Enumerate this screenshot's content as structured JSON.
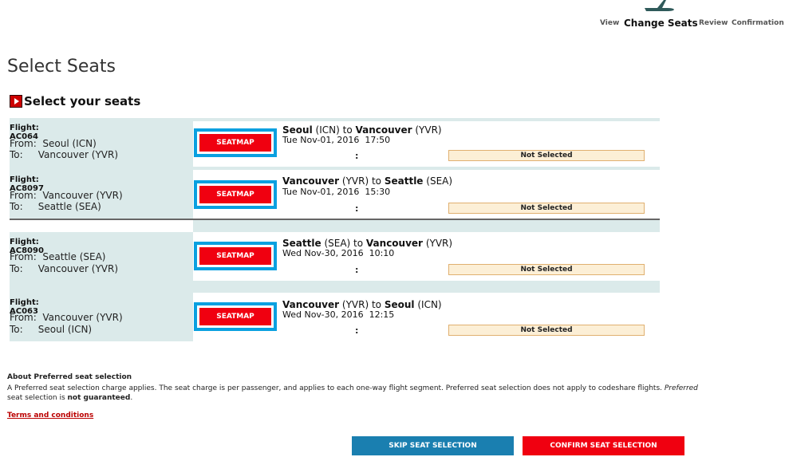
{
  "header": {
    "steps": [
      "View",
      "Change Seats",
      "Review",
      "Confirmation"
    ],
    "active_step": "Change Seats"
  },
  "page_title": "Select Seats",
  "section_title": "Select your seats",
  "flights": [
    {
      "flight_label": "Flight: AC064",
      "from": "From:  Seoul (ICN)",
      "to": "To:     Vancouver (YVR)",
      "route_from_city": "Seoul",
      "route_from_code": "(ICN)",
      "route_to_word": "to",
      "route_to_city": "Vancouver",
      "route_to_code": "(YVR)",
      "datetime": "Tue Nov-01, 2016  17:50",
      "seatmap": "SEATMAP",
      "seat_colon": ":",
      "status": "Not Selected"
    },
    {
      "flight_label": "Flight: AC8097",
      "from": "From:  Vancouver (YVR)",
      "to": "To:     Seattle (SEA)",
      "route_from_city": "Vancouver",
      "route_from_code": "(YVR)",
      "route_to_word": "to",
      "route_to_city": "Seattle",
      "route_to_code": "(SEA)",
      "datetime": "Tue Nov-01, 2016  15:30",
      "seatmap": "SEATMAP",
      "seat_colon": ":",
      "status": "Not Selected"
    },
    {
      "flight_label": "Flight: AC8090",
      "from": "From:  Seattle (SEA)",
      "to": "To:     Vancouver (YVR)",
      "route_from_city": "Seattle",
      "route_from_code": "(SEA)",
      "route_to_word": "to",
      "route_to_city": "Vancouver",
      "route_to_code": "(YVR)",
      "datetime": "Wed Nov-30, 2016  10:10",
      "seatmap": "SEATMAP",
      "seat_colon": ":",
      "status": "Not Selected"
    },
    {
      "flight_label": "Flight: AC063",
      "from": "From:  Vancouver (YVR)",
      "to": "To:     Seoul (ICN)",
      "route_from_city": "Vancouver",
      "route_from_code": "(YVR)",
      "route_to_word": "to",
      "route_to_city": "Seoul",
      "route_to_code": "(ICN)",
      "datetime": "Wed Nov-30, 2016  12:15",
      "seatmap": "SEATMAP",
      "seat_colon": ":",
      "status": "Not Selected"
    }
  ],
  "about": {
    "title": "About Preferred seat selection",
    "text1": "A Preferred seat selection charge applies. The seat charge is per passenger, and applies to each one-way flight segment. Preferred seat selection does not apply to codeshare flights. ",
    "text_italic": "Preferred",
    "text2": " seat selection is ",
    "text_bold": "not guaranteed",
    "text3": "."
  },
  "terms_link": "Terms and conditions",
  "buttons": {
    "skip": "SKIP SEAT SELECTION",
    "confirm": "CONFIRM SEAT SELECTION"
  },
  "colors": {
    "skip": "#1a7fb0",
    "confirm": "#f00010",
    "highlight": "#0aa0e0"
  }
}
